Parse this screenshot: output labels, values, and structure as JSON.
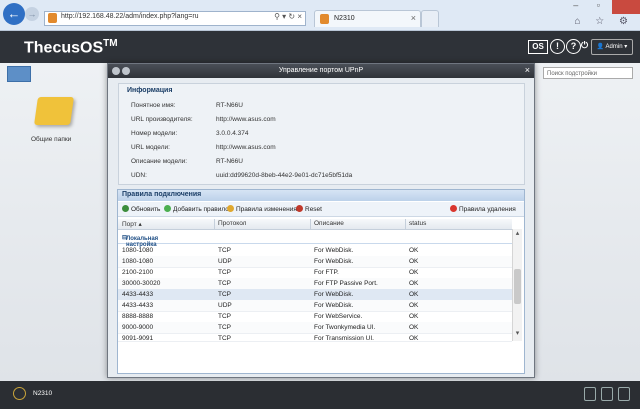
{
  "browser": {
    "url": "http://192.168.48.22/adm/index.php?lang=ru",
    "tab_title": "N2310"
  },
  "app": {
    "logo": "ThecusOS",
    "logo_tm": "TM",
    "os_badge": "OS",
    "user": "Admin"
  },
  "desktop": {
    "folder_label": "Общие папки",
    "search_placeholder": "Поиск подстройки"
  },
  "dialog": {
    "title": "Управление портом UPnP",
    "info": {
      "section_title": "Информация",
      "rows": [
        {
          "label": "Понятное имя:",
          "value": "RT-N66U"
        },
        {
          "label": "URL производителя:",
          "value": "http://www.asus.com"
        },
        {
          "label": "Номер модели:",
          "value": "3.0.0.4.374"
        },
        {
          "label": "URL модели:",
          "value": "http://www.asus.com"
        },
        {
          "label": "Описание модели:",
          "value": "RT-N66U"
        },
        {
          "label": "UDN:",
          "value": "uuid:dd99620d-8beb-44e2-9e01-dc71e5bf51da"
        }
      ]
    },
    "rules": {
      "section_title": "Правила подключения",
      "toolbar": {
        "refresh": "Обновить",
        "add": "Добавить правило",
        "edit": "Правила изменения",
        "reset": "Reset",
        "delete": "Правила удаления"
      },
      "columns": {
        "port": "Порт",
        "protocol": "Протокол",
        "description": "Описание",
        "status": "status"
      },
      "group_label": "Локальная настройка",
      "rows": [
        {
          "port": "1080-1080",
          "protocol": "TCP",
          "description": "For WebDisk.",
          "status": "OK"
        },
        {
          "port": "1080-1080",
          "protocol": "UDP",
          "description": "For WebDisk.",
          "status": "OK"
        },
        {
          "port": "2100-2100",
          "protocol": "TCP",
          "description": "For FTP.",
          "status": "OK"
        },
        {
          "port": "30000-30020",
          "protocol": "TCP",
          "description": "For FTP Passive Port.",
          "status": "OK"
        },
        {
          "port": "4433-4433",
          "protocol": "TCP",
          "description": "For WebDisk.",
          "status": "OK"
        },
        {
          "port": "4433-4433",
          "protocol": "UDP",
          "description": "For WebDisk.",
          "status": "OK"
        },
        {
          "port": "8888-8888",
          "protocol": "TCP",
          "description": "For WebService.",
          "status": "OK"
        },
        {
          "port": "9000-9000",
          "protocol": "TCP",
          "description": "For Twonkymedia UI.",
          "status": "OK"
        },
        {
          "port": "9091-9091",
          "protocol": "TCP",
          "description": "For Transmission UI.",
          "status": "OK"
        }
      ]
    }
  },
  "taskbar": {
    "device_name": "N2310"
  }
}
